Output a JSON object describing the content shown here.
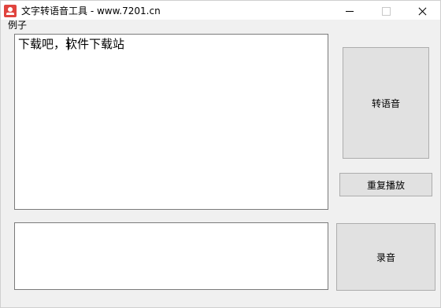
{
  "window": {
    "title": "文字转语音工具 - www.7201.cn",
    "icon": "app-icon"
  },
  "menu": {
    "items": [
      {
        "label": "例子"
      }
    ]
  },
  "main_text": {
    "value": "下载吧，软件下载站"
  },
  "record_text": {
    "value": ""
  },
  "buttons": {
    "convert_label": "转语音",
    "replay_label": "重复播放",
    "record_label": "录音"
  },
  "colors": {
    "window_bg": "#f0f0f0",
    "button_bg": "#e1e1e1",
    "button_border": "#adadad",
    "textbox_border": "#7a7a7a",
    "app_icon": "#e0443e"
  }
}
